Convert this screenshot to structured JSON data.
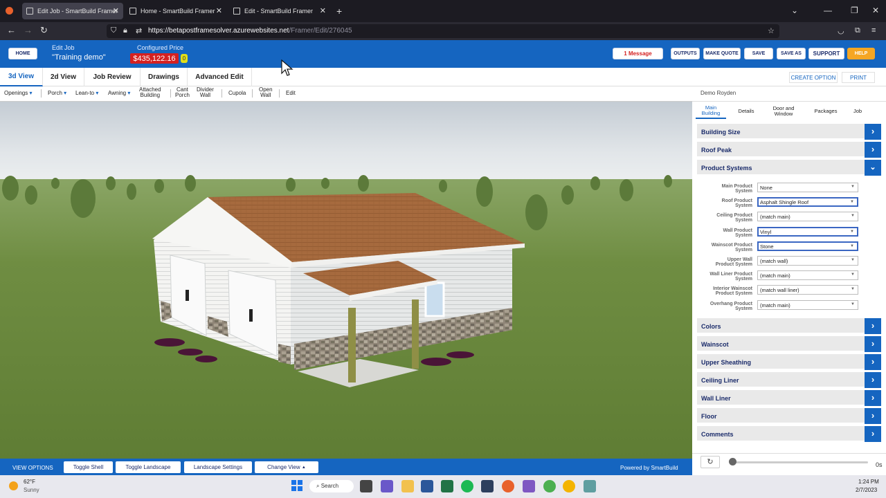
{
  "browser": {
    "tabs": [
      {
        "title": "Edit Job - SmartBuild Framer",
        "active": true
      },
      {
        "title": "Home - SmartBuild Framer",
        "active": false
      },
      {
        "title": "Edit - SmartBuild Framer",
        "active": false
      }
    ],
    "url_host": "https://betapostframesolver.azurewebsites.net",
    "url_path": "/Framer/Edit/276045"
  },
  "header": {
    "home_label": "HOME",
    "edit_job_label": "Edit Job",
    "job_name": "\"Training demo\"",
    "configured_price_label": "Configured Price",
    "price": "$435,122.16",
    "price_badge": "0",
    "message_label": "1 Message",
    "outputs_label": "OUTPUTS",
    "make_quote_label": "MAKE QUOTE",
    "save_label": "SAVE",
    "save_as_label": "SAVE AS",
    "support_label": "SUPPORT",
    "help_label": "HELP"
  },
  "view_tabs": [
    "3d View",
    "2d View",
    "Job Review",
    "Drawings",
    "Advanced Edit"
  ],
  "right_top": {
    "create_option": "CREATE OPTION",
    "print": "PRINT"
  },
  "toolbar": {
    "openings": "Openings",
    "porch": "Porch",
    "lean_to": "Lean-to",
    "awning": "Awning",
    "attached_1": "Attached",
    "attached_2": "Building",
    "cant_1": "Cant",
    "cant_2": "Porch",
    "divider_1": "Divider",
    "divider_2": "Wall",
    "cupola": "Cupola",
    "open_1": "Open",
    "open_2": "Wall",
    "edit": "Edit"
  },
  "customer_name": "Demo Royden",
  "panel_tabs": {
    "main_1": "Main",
    "main_2": "Building",
    "details": "Details",
    "door_1": "Door and",
    "door_2": "Window",
    "packages": "Packages",
    "job": "Job"
  },
  "accordions_top": [
    "Building Size",
    "Roof Peak",
    "Product Systems"
  ],
  "product_systems": [
    {
      "l1": "Main Product",
      "l2": "System",
      "value": "None",
      "hl": false
    },
    {
      "l1": "Roof Product",
      "l2": "System",
      "value": "Asphalt Shingle Roof",
      "hl": true
    },
    {
      "l1": "Ceiling Product",
      "l2": "System",
      "value": "(match main)",
      "hl": false
    },
    {
      "l1": "Wall Product",
      "l2": "System",
      "value": "Vinyl",
      "hl": true
    },
    {
      "l1": "Wainscot Product",
      "l2": "System",
      "value": "Stone",
      "hl": true
    },
    {
      "l1": "Upper Wall",
      "l2": "Product System",
      "value": "(match wall)",
      "hl": false
    },
    {
      "l1": "Wall Liner Product",
      "l2": "System",
      "value": "(match main)",
      "hl": false
    },
    {
      "l1": "Interior Wainscot",
      "l2": "Product System",
      "value": "(match wall liner)",
      "hl": false
    },
    {
      "l1": "Overhang Product",
      "l2": "System",
      "value": "(match main)",
      "hl": false
    }
  ],
  "accordions_bottom": [
    "Colors",
    "Wainscot",
    "Upper Sheathing",
    "Ceiling Liner",
    "Wall Liner",
    "Floor",
    "Comments"
  ],
  "bottom_bar": {
    "view_options": "VIEW OPTIONS",
    "toggle_shell": "Toggle Shell",
    "toggle_landscape": "Toggle Landscape",
    "landscape_settings": "Landscape Settings",
    "change_view": "Change View",
    "powered": "Powered by SmartBuild"
  },
  "timeline_label": "0s",
  "taskbar": {
    "temp": "62°F",
    "weather": "Sunny",
    "search": "Search",
    "time": "1:24 PM",
    "date": "2/7/2023"
  },
  "colors": {
    "brand_blue": "#1565c0",
    "price_red": "#d42020",
    "help_orange": "#f5a623"
  }
}
